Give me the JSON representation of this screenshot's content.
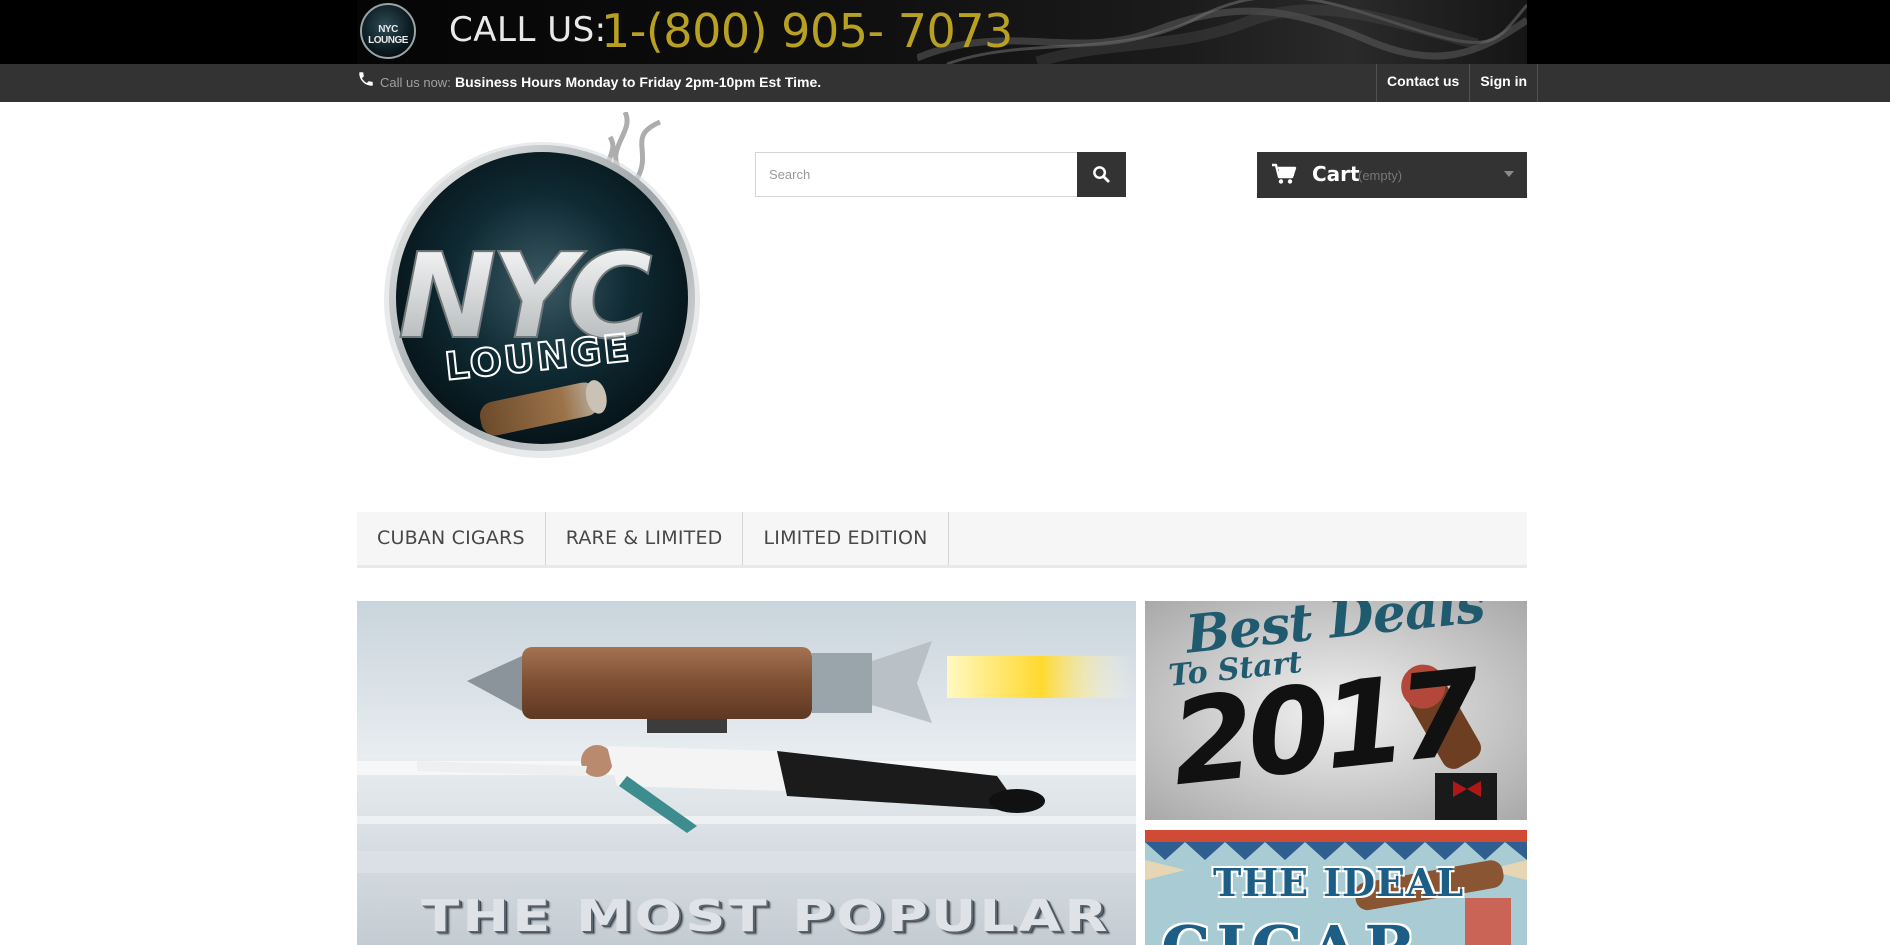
{
  "top_banner": {
    "logo_text": "NYC LOUNGE",
    "call_label": "CALL US:",
    "phone_number": "1-(800) 905- 7073"
  },
  "nav": {
    "call_now_label": "Call us now:",
    "business_hours": "Business Hours Monday to Friday 2pm-10pm Est Time.",
    "links": [
      "Contact us",
      "Sign in"
    ]
  },
  "logo": {
    "line1": "NYC",
    "line2": "LOUNGE"
  },
  "search": {
    "placeholder": "Search"
  },
  "cart": {
    "label": "Cart",
    "status": "(empty)"
  },
  "menu": {
    "items": [
      "CUBAN CIGARS",
      "RARE & LIMITED",
      "LIMITED EDITION"
    ]
  },
  "banners": {
    "hero_title": "THE MOST POPULAR",
    "deals_line1": "Best Deals",
    "deals_line2": "To Start",
    "deals_year": "2017",
    "ideal_line1": "THE IDEAL",
    "ideal_line2": "CIGAR"
  },
  "colors": {
    "dark": "#333333",
    "phone_gold": "#b8a122",
    "accent_teal": "#1f5a6e",
    "ideal_blue": "#1c5e86"
  }
}
